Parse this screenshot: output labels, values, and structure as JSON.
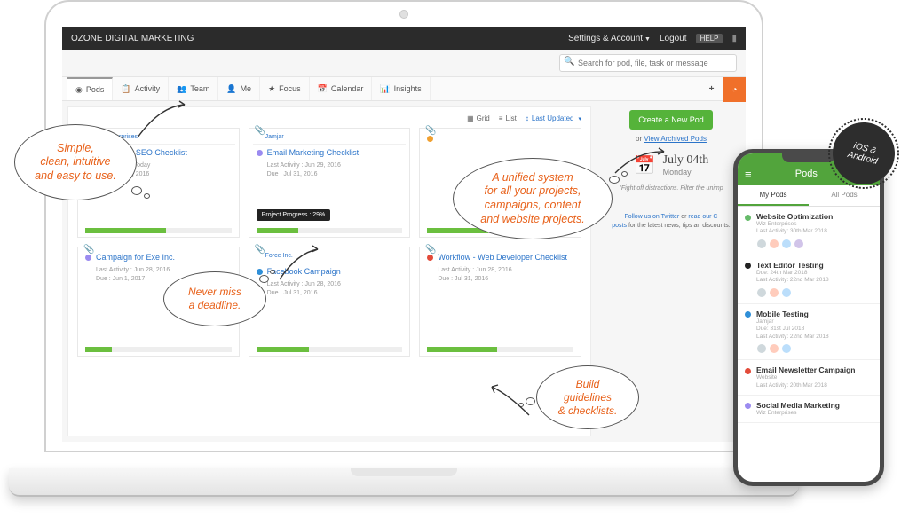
{
  "topbar": {
    "brand": "OZONE DIGITAL MARKETING",
    "settings": "Settings & Account",
    "logout": "Logout",
    "help": "HELP"
  },
  "search": {
    "placeholder": "Search for pod, file, task or message"
  },
  "tabs": {
    "items": [
      {
        "label": "Pods",
        "icon": "◉"
      },
      {
        "label": "Activity",
        "icon": "📋"
      },
      {
        "label": "Team",
        "icon": "👥"
      },
      {
        "label": "Me",
        "icon": "👤"
      },
      {
        "label": "Focus",
        "icon": "★"
      },
      {
        "label": "Calendar",
        "icon": "📅"
      },
      {
        "label": "Insights",
        "icon": "📊"
      }
    ]
  },
  "view": {
    "grid": "Grid",
    "list": "List",
    "sort": "Last Updated"
  },
  "cards": [
    {
      "company": "Wiz Enterprises",
      "dot": "#d48fd4",
      "title": "Workflow - SEO Checklist",
      "activity": "Last Activity : Today",
      "due": "Due : Sep 28, 2016",
      "progress": 55
    },
    {
      "company": "Jamjar",
      "dot": "#9b8bf0",
      "title": "Email Marketing Checklist",
      "activity": "Last Activity : Jun 29, 2016",
      "due": "Due : Jul 31, 2016",
      "progress": 29,
      "tooltip": "Project Progress : 29%"
    },
    {
      "company": "",
      "dot": "#f0a030",
      "title": "",
      "activity": "",
      "due": "",
      "progress": 42
    },
    {
      "company": "",
      "dot": "#9b8bf0",
      "title": "Campaign for Exe Inc.",
      "activity": "Last Activity : Jun 28, 2016",
      "due": "Due : Jun 1, 2017",
      "progress": 18
    },
    {
      "company": "Force Inc.",
      "dot": "#2f8fd8",
      "title": "Facebook Campaign",
      "activity": "Last Activity : Jun 28, 2016",
      "due": "Due : Jul 31, 2016",
      "progress": 36
    },
    {
      "company": "",
      "dot": "#e34b3a",
      "title": "Workflow - Web Developer Checklist",
      "activity": "Last Activity : Jun 28, 2016",
      "due": "Due : Jul 31, 2016",
      "progress": 48
    }
  ],
  "rail": {
    "create": "Create a New Pod",
    "or": "or",
    "archived": "View Archived Pods",
    "date_big": "July 04th",
    "date_small": "Monday",
    "tagline": "\"Fight off distractions. Filter the unimp",
    "social_pre": "Follow us on Twitter",
    "social_mid": " or ",
    "social_post": "read our C",
    "social_line2": "posts",
    "social_tail": " for the latest news, tips an discounts."
  },
  "phone": {
    "title": "Pods",
    "tab_my": "My Pods",
    "tab_all": "All Pods",
    "items": [
      {
        "dot": "#66bb6a",
        "title": "Website Optimization",
        "sub": "Wiz Enterprises",
        "meta": "Last Activity: 30th Mar 2018",
        "avatars": 4
      },
      {
        "dot": "#222",
        "title": "Text Editor Testing",
        "sub": "",
        "meta": "Due: 24th Mar 2018\nLast Activity: 22nd Mar 2018",
        "avatars": 3
      },
      {
        "dot": "#2f8fd8",
        "title": "Mobile Testing",
        "sub": "Jamjar",
        "meta": "Due: 31st Jul 2018\nLast Activity: 22nd Mar 2018",
        "avatars": 3
      },
      {
        "dot": "#e34b3a",
        "title": "Email Newsletter Campaign",
        "sub": "Website",
        "meta": "Last Activity: 20th Mar 2018",
        "avatars": 0
      },
      {
        "dot": "#9b8bf0",
        "title": "Social Media Marketing",
        "sub": "Wiz Enterprises",
        "meta": "",
        "avatars": 0
      }
    ]
  },
  "clouds": {
    "c1": "Simple,\nclean, intuitive\nand easy to use.",
    "c2": "Never miss\na deadline.",
    "c3": "A unified system\nfor all your projects,\ncampaigns, content\nand website projects.",
    "c4": "Build\nguidelines\n& checklists."
  },
  "badge": "iOS &\nAndroid"
}
